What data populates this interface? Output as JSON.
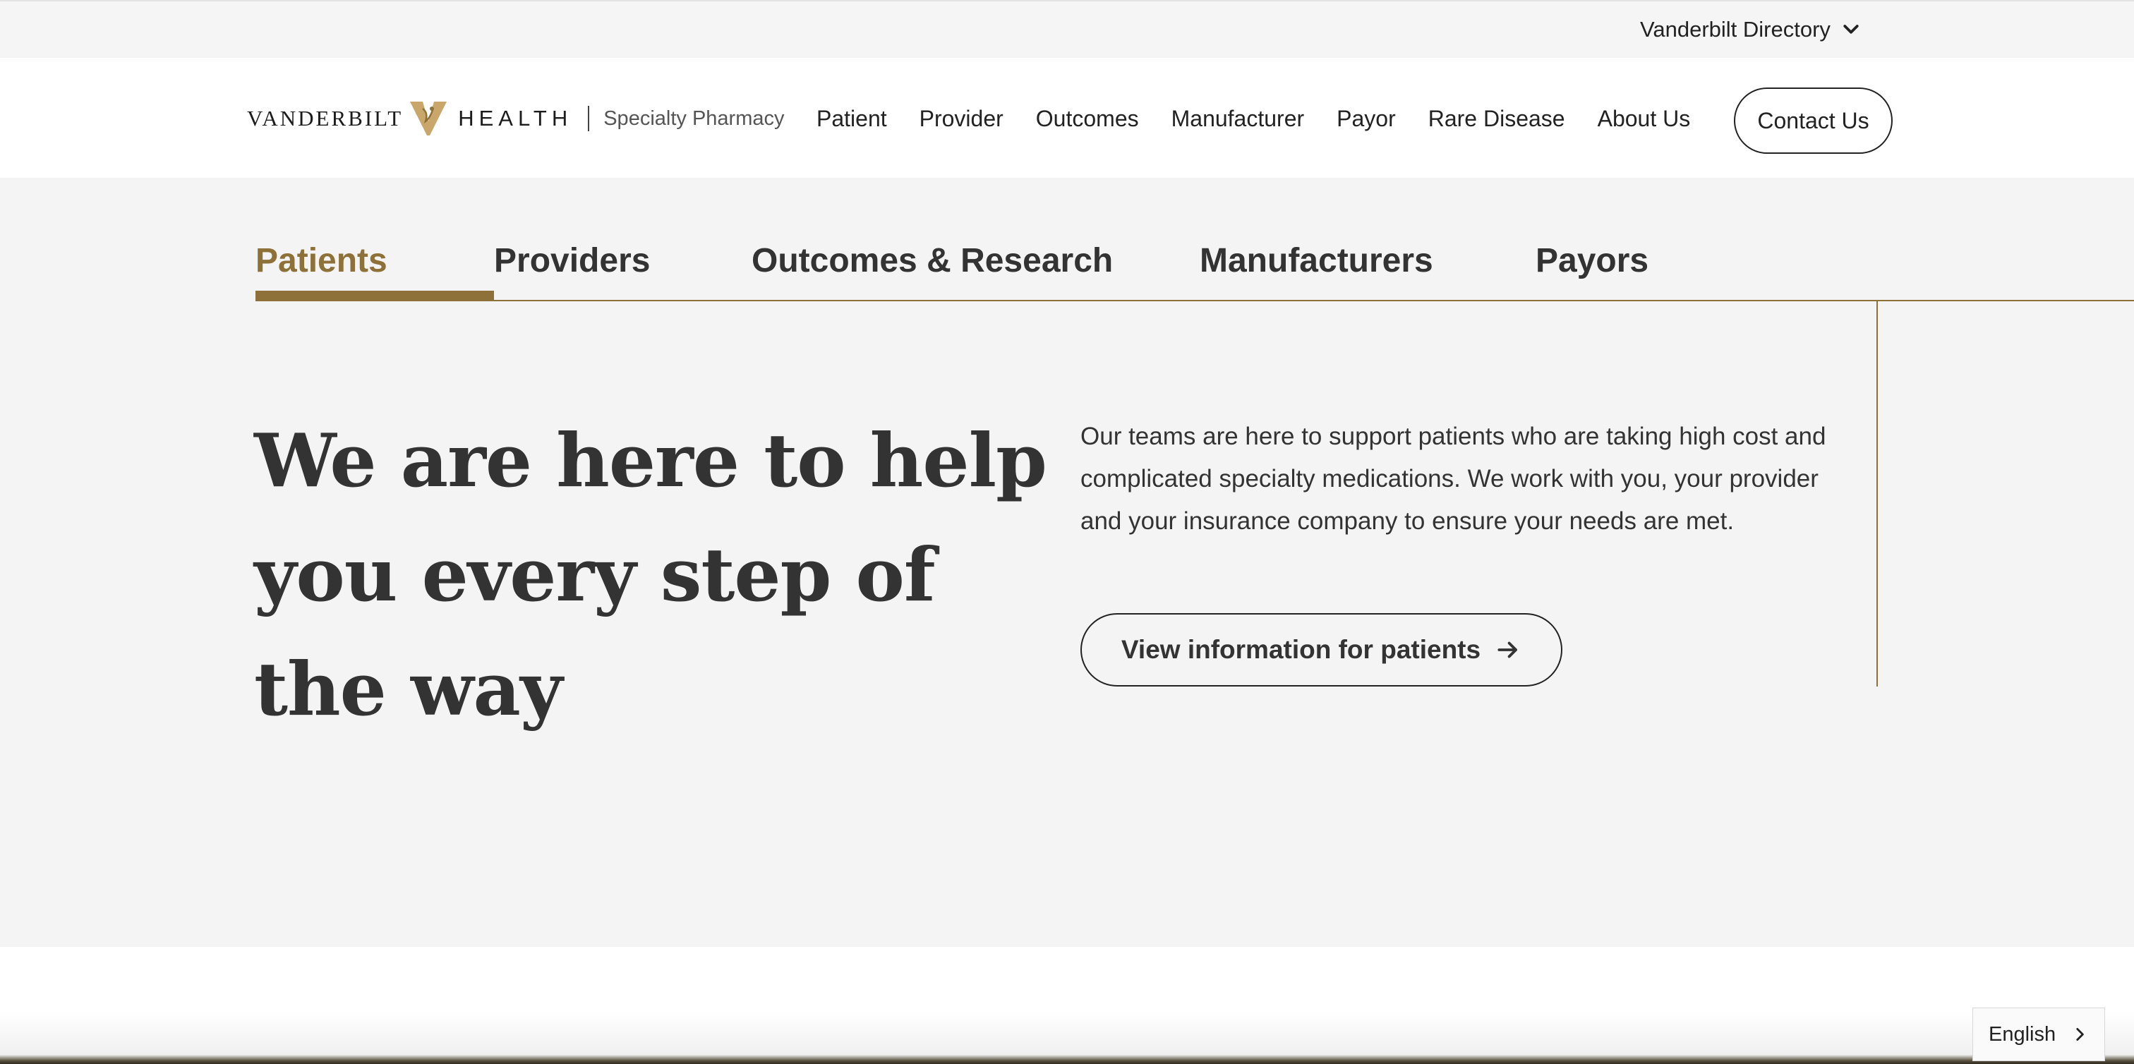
{
  "utility_bar": {
    "directory_label": "Vanderbilt Directory"
  },
  "header": {
    "logo": {
      "wordmark_left": "VANDERBILT",
      "wordmark_right": "HEALTH",
      "subtitle": "Specialty Pharmacy"
    },
    "nav": [
      "Patient",
      "Provider",
      "Outcomes",
      "Manufacturer",
      "Payor",
      "Rare Disease",
      "About Us"
    ],
    "contact_label": "Contact Us"
  },
  "hero": {
    "tabs": [
      {
        "label": "Patients",
        "active": true
      },
      {
        "label": "Providers",
        "active": false
      },
      {
        "label": "Outcomes & Research",
        "active": false
      },
      {
        "label": "Manufacturers",
        "active": false
      },
      {
        "label": "Payors",
        "active": false
      }
    ],
    "headline": "We are here to help you every step of the way",
    "intro": "Our teams are here to support patients who are taking high cost and complicated specialty medications. We work with you, your provider and your insurance company to ensure your needs are met.",
    "cta_label": "View information for patients"
  },
  "language": {
    "selected": "English"
  },
  "icons": {
    "directory": "chevron-down-icon",
    "cta": "arrow-right-icon",
    "language": "chevron-right-icon",
    "logo": "vanderbilt-v-logo-icon"
  },
  "colors": {
    "accent_gold": "#8e7139",
    "text": "#333333",
    "hero_bg": "#f4f4f4",
    "utility_bg": "#f5f5f5"
  }
}
